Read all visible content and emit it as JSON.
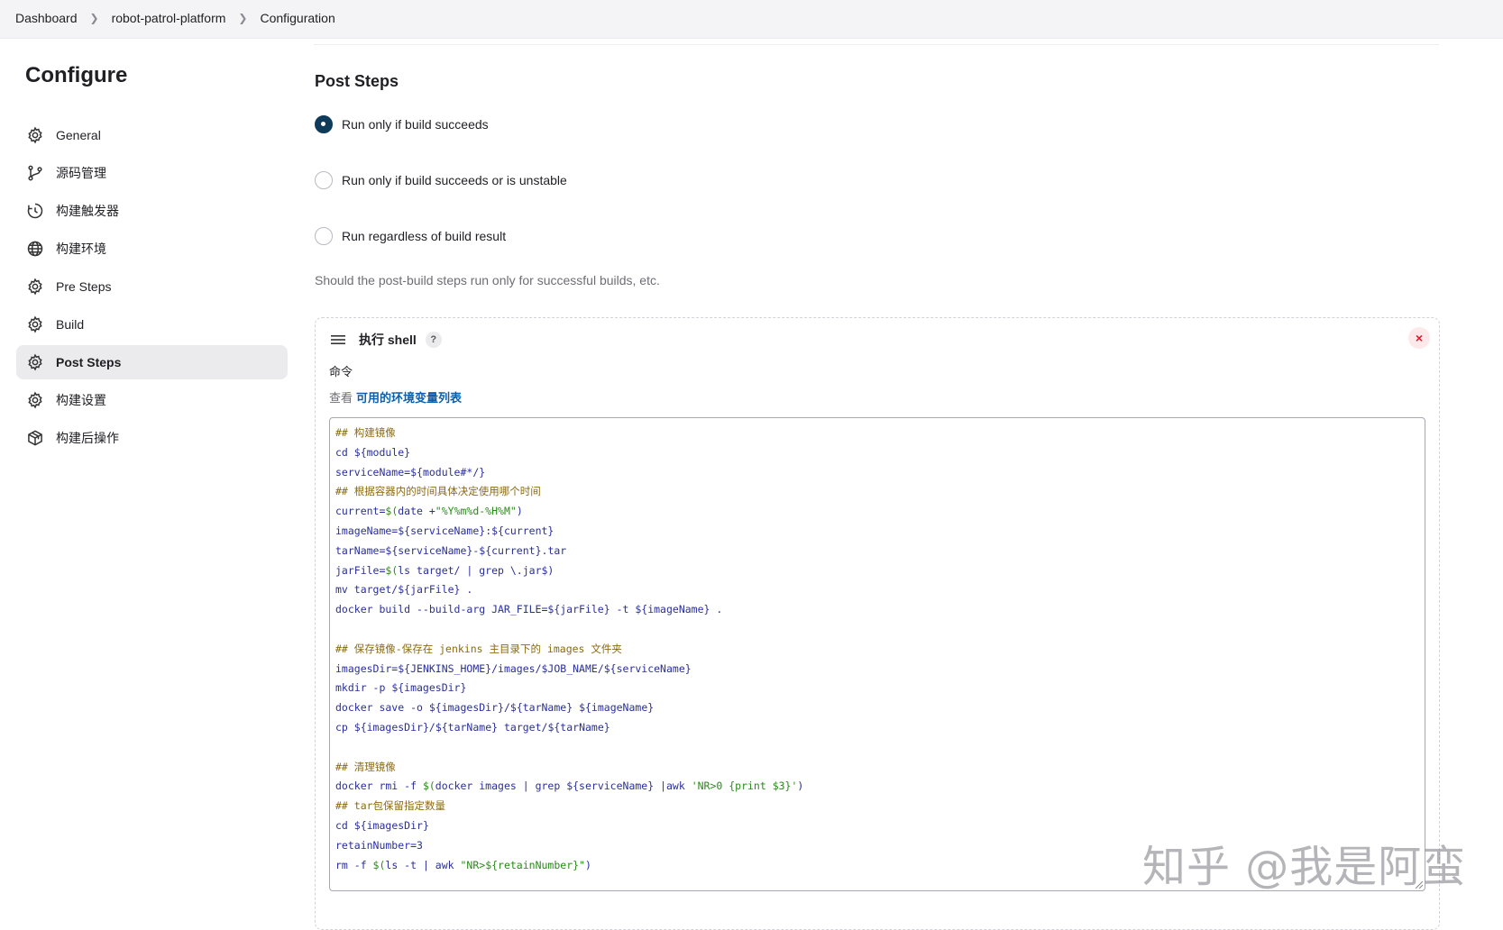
{
  "breadcrumb": [
    "Dashboard",
    "robot-patrol-platform",
    "Configuration"
  ],
  "page_title": "Configure",
  "sidebar": {
    "items": [
      {
        "label": "General",
        "icon": "gear-icon",
        "active": false
      },
      {
        "label": "源码管理",
        "icon": "branch-icon",
        "active": false
      },
      {
        "label": "构建触发器",
        "icon": "clock-icon",
        "active": false
      },
      {
        "label": "构建环境",
        "icon": "globe-icon",
        "active": false
      },
      {
        "label": "Pre Steps",
        "icon": "gear-icon",
        "active": false
      },
      {
        "label": "Build",
        "icon": "gear-icon",
        "active": false
      },
      {
        "label": "Post Steps",
        "icon": "gear-icon",
        "active": true
      },
      {
        "label": "构建设置",
        "icon": "gear-icon",
        "active": false
      },
      {
        "label": "构建后操作",
        "icon": "package-icon",
        "active": false
      }
    ]
  },
  "main": {
    "section_title": "Post Steps",
    "radios": [
      {
        "label": "Run only if build succeeds",
        "checked": true
      },
      {
        "label": "Run only if build succeeds or is unstable",
        "checked": false
      },
      {
        "label": "Run regardless of build result",
        "checked": false
      }
    ],
    "help_text": "Should the post-build steps run only for successful builds, etc.",
    "shell": {
      "title": "执行 shell",
      "help_label": "?",
      "close_label": "×",
      "command_label": "命令",
      "env_prefix": "查看",
      "env_link": "可用的环境变量列表",
      "code_lines": [
        "## 构建镜像",
        "cd ${module}",
        "serviceName=${module#*/}",
        "## 根据容器内的时间具体决定使用哪个时间",
        "current=$(date +\"%Y%m%d-%H%M\")",
        "imageName=${serviceName}:${current}",
        "tarName=${serviceName}-${current}.tar",
        "jarFile=$(ls target/ | grep \\.jar$)",
        "mv target/${jarFile} .",
        "docker build --build-arg JAR_FILE=${jarFile} -t ${imageName} .",
        "",
        "## 保存镜像-保存在 jenkins 主目录下的 images 文件夹",
        "imagesDir=${JENKINS_HOME}/images/$JOB_NAME/${serviceName}",
        "mkdir -p ${imagesDir}",
        "docker save -o ${imagesDir}/${tarName} ${imageName}",
        "cp ${imagesDir}/${tarName} target/${tarName}",
        "",
        "## 清理镜像",
        "docker rmi -f $(docker images | grep ${serviceName} |awk 'NR>0 {print $3}')",
        "## tar包保留指定数量",
        "cd ${imagesDir}",
        "retainNumber=3",
        "rm -f $(ls -t | awk \"NR>${retainNumber}\")"
      ]
    }
  },
  "watermark": "知乎 @我是阿蛮",
  "colors": {
    "accent": "#0f3b5a",
    "link": "#0f5ea8",
    "danger": "#d51d2c",
    "comment": "#8a6a12",
    "variable": "#2a2f9a",
    "string": "#2a8a1a"
  }
}
